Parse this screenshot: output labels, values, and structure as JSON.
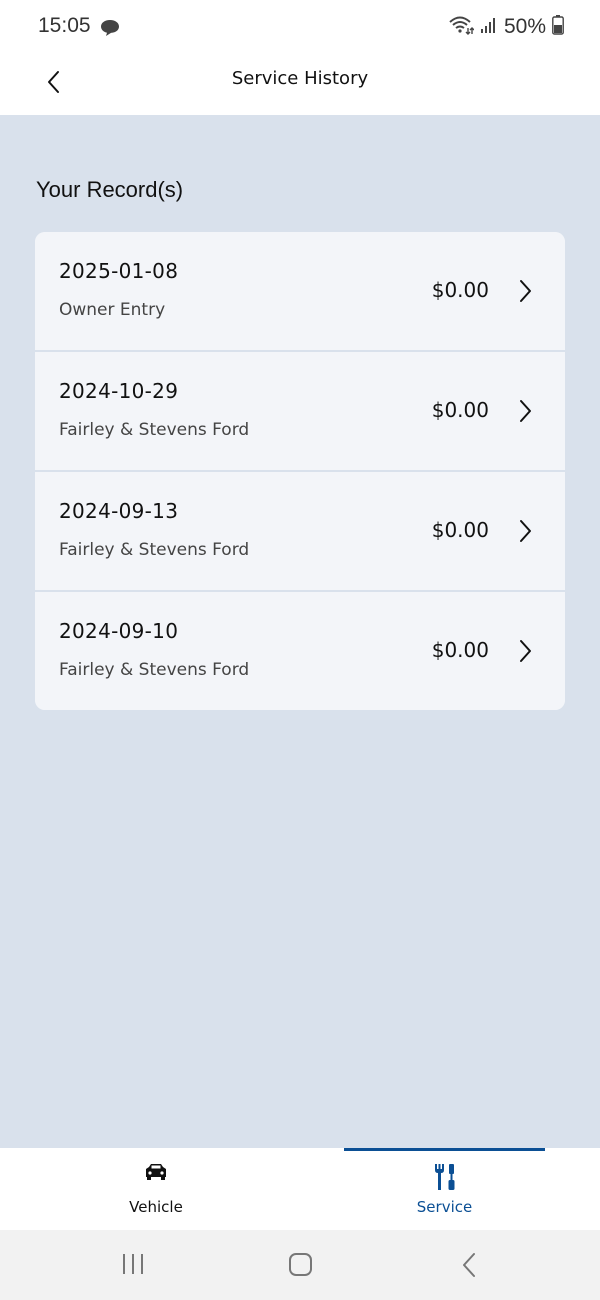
{
  "status_bar": {
    "time": "15:05",
    "battery_text": "50%"
  },
  "header": {
    "title": "Service History"
  },
  "main": {
    "section_title": "Your Record(s)",
    "records": [
      {
        "date": "2025-01-08",
        "source": "Owner Entry",
        "amount": "$0.00"
      },
      {
        "date": "2024-10-29",
        "source": "Fairley & Stevens Ford",
        "amount": "$0.00"
      },
      {
        "date": "2024-09-13",
        "source": "Fairley & Stevens Ford",
        "amount": "$0.00"
      },
      {
        "date": "2024-09-10",
        "source": "Fairley & Stevens Ford",
        "amount": "$0.00"
      }
    ]
  },
  "bottom_nav": {
    "items": [
      {
        "label": "Vehicle",
        "icon": "car-icon",
        "active": false
      },
      {
        "label": "Service",
        "icon": "service-tools-icon",
        "active": true
      }
    ]
  },
  "colors": {
    "accent": "#0b4f94",
    "page_background": "#d9e1ec",
    "card_background": "#f3f5f9"
  }
}
